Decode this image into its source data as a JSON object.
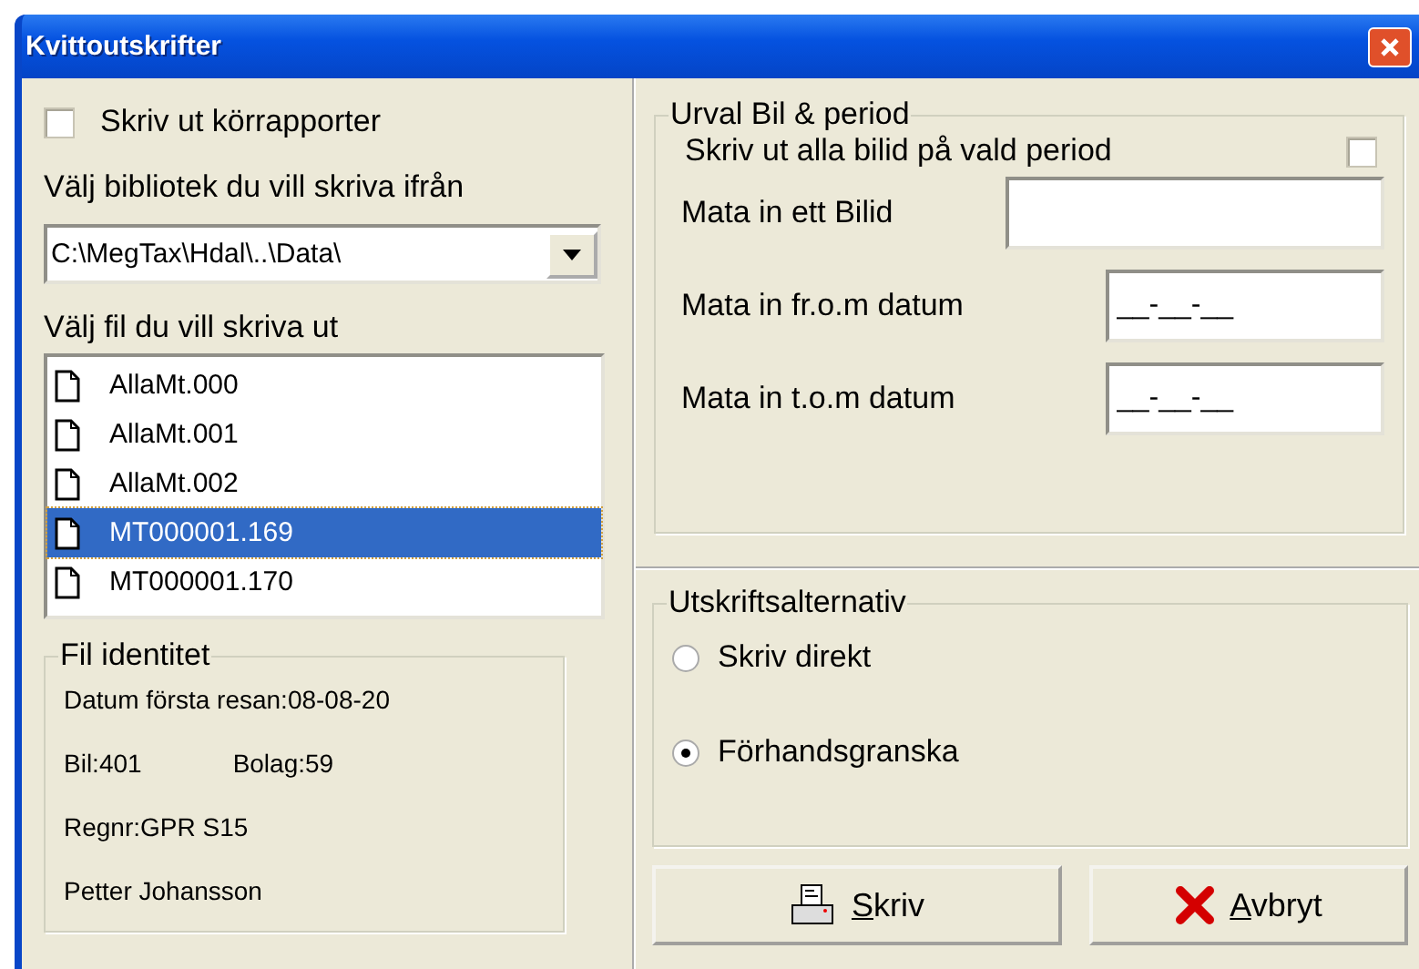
{
  "window": {
    "title": "Kvittoutskrifter"
  },
  "left": {
    "print_reports": {
      "label": "Skriv ut körrapporter",
      "checked": false
    },
    "directory_label": "Välj bibliotek du vill skriva ifrån",
    "directory": {
      "value": "C:\\MegTax\\Hdal\\..\\Data\\"
    },
    "file_label": "Välj fil du vill skriva ut",
    "files": [
      {
        "name": "AllaMt.000",
        "selected": false
      },
      {
        "name": "AllaMt.001",
        "selected": false
      },
      {
        "name": "AllaMt.002",
        "selected": false
      },
      {
        "name": "MT000001.169",
        "selected": true
      },
      {
        "name": "MT000001.170",
        "selected": false
      }
    ],
    "file_identity": {
      "title": "Fil identitet",
      "first_trip": "Datum första resan:08-08-20",
      "car": "Bil:401",
      "company": "Bolag:59",
      "regnr": "Regnr:GPR S15",
      "driver": "Petter Johansson"
    }
  },
  "selection": {
    "title": "Urval Bil & period",
    "all_cars": {
      "label": "Skriv ut alla bilid på vald period",
      "checked": false
    },
    "car_id": {
      "label": "Mata in ett Bilid"
    },
    "from_date": {
      "label": "Mata in fr.o.m datum",
      "value": "__-__-__"
    },
    "to_date": {
      "label": "Mata in t.o.m datum",
      "value": "__-__-__"
    }
  },
  "output": {
    "title": "Utskriftsalternativ",
    "options": [
      {
        "label": "Skriv direkt",
        "selected": false
      },
      {
        "label": "Förhandsgranska",
        "selected": true
      }
    ]
  },
  "buttons": [
    {
      "kind": "print",
      "label": "Skriv"
    },
    {
      "kind": "cancel",
      "label": "Avbryt"
    }
  ]
}
